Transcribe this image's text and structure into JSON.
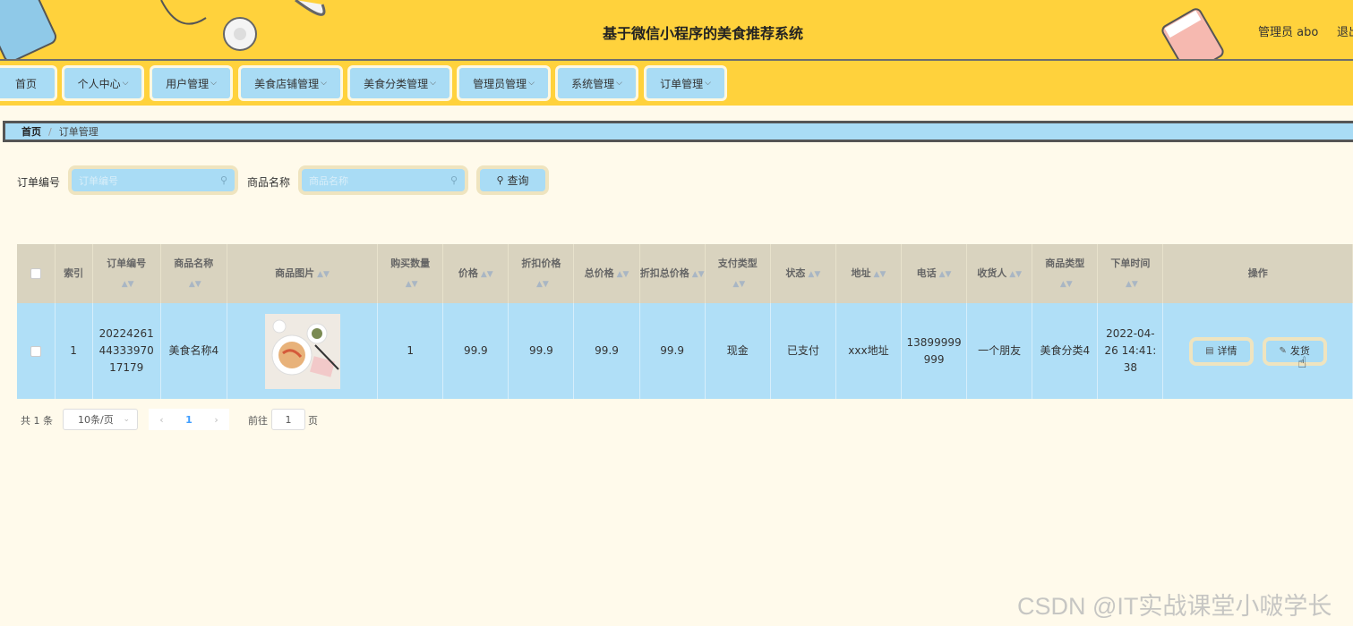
{
  "header": {
    "title": "基于微信小程序的美食推荐系统",
    "admin_label": "管理员 abo",
    "logout_label": "退出"
  },
  "nav": {
    "items": [
      {
        "label": "首页",
        "has_dropdown": false
      },
      {
        "label": "个人中心",
        "has_dropdown": true
      },
      {
        "label": "用户管理",
        "has_dropdown": true
      },
      {
        "label": "美食店铺管理",
        "has_dropdown": true
      },
      {
        "label": "美食分类管理",
        "has_dropdown": true
      },
      {
        "label": "管理员管理",
        "has_dropdown": true
      },
      {
        "label": "系统管理",
        "has_dropdown": true
      },
      {
        "label": "订单管理",
        "has_dropdown": true
      }
    ],
    "chevron": "⌵"
  },
  "breadcrumb": {
    "home": "首页",
    "separator": "/",
    "current": "订单管理"
  },
  "search": {
    "order_no_label": "订单编号",
    "order_no_placeholder": "订单编号",
    "product_label": "商品名称",
    "product_placeholder": "商品名称",
    "query_label": "查询"
  },
  "table": {
    "columns": [
      "索引",
      "订单编号",
      "商品名称",
      "商品图片",
      "购买数量",
      "价格",
      "折扣价格",
      "总价格",
      "折扣总价格",
      "支付类型",
      "状态",
      "地址",
      "电话",
      "收货人",
      "商品类型",
      "下单时间",
      "操作"
    ],
    "rows": [
      {
        "index": "1",
        "order_no": "20224261443339701 7179",
        "order_no_lines": [
          "20224261",
          "44333970",
          "17179"
        ],
        "product_name": "美食名称4",
        "quantity": "1",
        "price": "99.9",
        "discount_price": "99.9",
        "total_price": "99.9",
        "discount_total": "99.9",
        "pay_type": "现金",
        "status": "已支付",
        "address": "xxx地址",
        "phone_lines": [
          "13899999",
          "999"
        ],
        "receiver": "一个朋友",
        "product_type": "美食分类4",
        "order_time_lines": [
          "2022-04-",
          "26 14:41:",
          "38"
        ]
      }
    ],
    "actions": {
      "detail": "详情",
      "ship": "发货"
    }
  },
  "pagination": {
    "total": "共 1 条",
    "page_size": "10条/页",
    "current_page": "1",
    "goto_label": "前往",
    "goto_value": "1",
    "page_word": "页"
  },
  "watermark": "CSDN @IT实战课堂小啵学长",
  "colors": {
    "header_bg": "#ffd23c",
    "nav_item_bg": "#a9dcf5",
    "page_bg": "#fffaeb",
    "table_header_bg": "#d9d3bf",
    "row_bg": "#b0dff7"
  }
}
